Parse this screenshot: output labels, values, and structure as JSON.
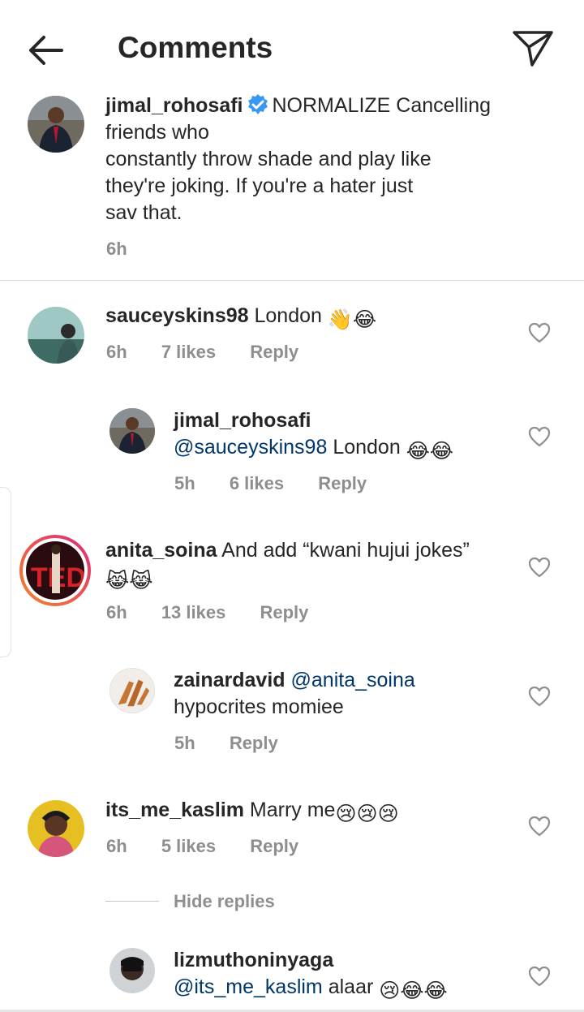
{
  "header": {
    "title": "Comments",
    "back_icon": "back-arrow-icon",
    "send_icon": "paper-plane-icon"
  },
  "caption": {
    "username": "jimal_rohosafi",
    "verified": true,
    "text_line1": "NORMALIZE Cancelling",
    "text_line2": "friends who",
    "text_line3": "constantly throw shade and play like",
    "text_line4": "they're joking. If you're a hater just",
    "text_line5": "sav that.",
    "time": "6h"
  },
  "comments": [
    {
      "username": "sauceyskins98",
      "text": "London",
      "emojis": "👋😂",
      "time": "6h",
      "likes": "7 likes",
      "reply": "Reply"
    },
    {
      "username": "jimal_rohosafi",
      "mention": "@sauceyskins98",
      "text": "London",
      "emojis": "😂😂",
      "time": "5h",
      "likes": "6 likes",
      "reply": "Reply"
    },
    {
      "username": "anita_soina",
      "text": "And add “kwani hujui jokes”",
      "emojis": "😹😹",
      "time": "6h",
      "likes": "13 likes",
      "reply": "Reply"
    },
    {
      "username": "zainardavid",
      "mention": "@anita_soina",
      "text": "hypocrites momiee",
      "time": "5h",
      "reply": "Reply"
    },
    {
      "username": "its_me_kaslim",
      "text": "Marry me",
      "emojis": "😢😢😢",
      "time": "6h",
      "likes": "5 likes",
      "reply": "Reply"
    },
    {
      "username": "lizmuthoninyaga",
      "mention": "@its_me_kaslim",
      "text": "alaar",
      "emojis": "😢😂😂"
    }
  ],
  "hide_replies": "Hide replies",
  "colors": {
    "text": "#262626",
    "muted": "#8e8e8e",
    "mention": "#00376b",
    "verified": "#3897f0",
    "story_ring_start": "#f58529",
    "story_ring_end": "#dd2a7b"
  }
}
